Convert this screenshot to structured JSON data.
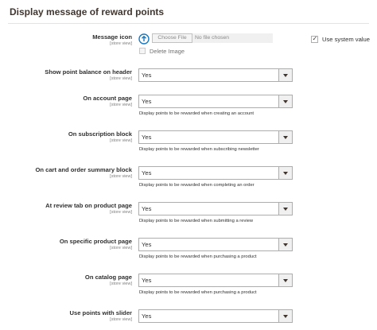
{
  "section": {
    "title": "Display message of reward points"
  },
  "message_icon": {
    "label": "Message icon",
    "scope": "[store view]",
    "icon": "upload-icon",
    "choose_button": "Choose File",
    "file_status": "No file chosen",
    "delete_label": "Delete Image",
    "delete_checked": false,
    "use_system_value_label": "Use system value",
    "use_system_value_checked": true
  },
  "rows": [
    {
      "label": "Show point balance on header",
      "scope": "[store view]",
      "value": "Yes",
      "note": ""
    },
    {
      "label": "On account page",
      "scope": "[store view]",
      "value": "Yes",
      "note": "Display points to be rewarded when creating an account"
    },
    {
      "label": "On subscription block",
      "scope": "[store view]",
      "value": "Yes",
      "note": "Display points to be rewarded when subscribing newsletter"
    },
    {
      "label": "On cart and order summary block",
      "scope": "[store view]",
      "value": "Yes",
      "note": "Display points to be rewarded when completing an order"
    },
    {
      "label": "At review tab on product page",
      "scope": "[store view]",
      "value": "Yes",
      "note": "Display points to be rewarded when submitting a review"
    },
    {
      "label": "On specific product page",
      "scope": "[store view]",
      "value": "Yes",
      "note": "Display points to be rewarded when purchasing a product"
    },
    {
      "label": "On catalog page",
      "scope": "[store view]",
      "value": "Yes",
      "note": "Display points to be rewarded when purchasing a product"
    },
    {
      "label": "Use points with slider",
      "scope": "[store view]",
      "value": "Yes",
      "note": ""
    }
  ],
  "colors": {
    "title_text": "#41362f",
    "border": "#adadad",
    "arrow_bg": "#f0f0f0"
  }
}
